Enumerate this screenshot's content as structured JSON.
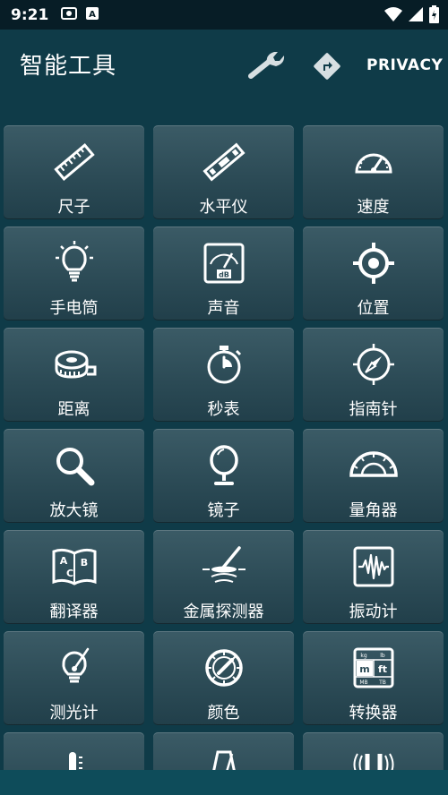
{
  "status_bar": {
    "time": "9:21"
  },
  "app_bar": {
    "title": "智能工具",
    "privacy_label": "PRIVACY"
  },
  "tools": [
    {
      "label": "尺子",
      "icon": "ruler-icon"
    },
    {
      "label": "水平仪",
      "icon": "spirit-level-icon"
    },
    {
      "label": "速度",
      "icon": "speedometer-icon"
    },
    {
      "label": "手电筒",
      "icon": "lightbulb-icon"
    },
    {
      "label": "声音",
      "icon": "sound-meter-icon"
    },
    {
      "label": "位置",
      "icon": "location-target-icon"
    },
    {
      "label": "距离",
      "icon": "tape-measure-icon"
    },
    {
      "label": "秒表",
      "icon": "stopwatch-icon"
    },
    {
      "label": "指南针",
      "icon": "compass-icon"
    },
    {
      "label": "放大镜",
      "icon": "magnifier-icon"
    },
    {
      "label": "镜子",
      "icon": "mirror-icon"
    },
    {
      "label": "量角器",
      "icon": "protractor-icon"
    },
    {
      "label": "翻译器",
      "icon": "translator-book-icon"
    },
    {
      "label": "金属探测器",
      "icon": "metal-detector-icon"
    },
    {
      "label": "振动计",
      "icon": "vibration-meter-icon"
    },
    {
      "label": "测光计",
      "icon": "light-meter-icon"
    },
    {
      "label": "颜色",
      "icon": "color-palette-icon"
    },
    {
      "label": "转换器",
      "icon": "unit-converter-icon"
    },
    {
      "label": "",
      "icon": "thermometer-icon"
    },
    {
      "label": "",
      "icon": "metronome-icon"
    },
    {
      "label": "",
      "icon": "magnet-icon"
    }
  ]
}
